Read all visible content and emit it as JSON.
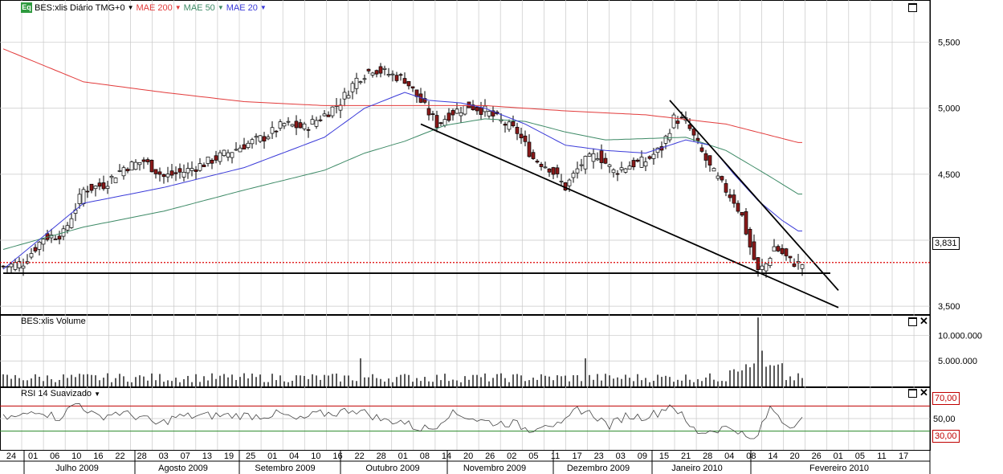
{
  "header": {
    "logo": "Eq",
    "symbol": "BES:xlis Diário TMG+0",
    "ma200": "MAE 200",
    "ma50": "MAE 50",
    "ma20": "MAE 20",
    "last_price": "3,831"
  },
  "volume_panel": {
    "title": "BES:xlis Volume",
    "ticks": [
      "10.000.000",
      "5.000.000"
    ]
  },
  "rsi_panel": {
    "title": "RSI 14 Suavizado",
    "upper": "70,00",
    "mid": "50,00",
    "lower": "30,00"
  },
  "colors": {
    "ma200": "#e23b3b",
    "ma50": "#3d8a66",
    "ma20": "#3b3bd9",
    "up": "#ffffff",
    "down": "#8b1a1a",
    "grid": "#c8c8c8"
  },
  "chart_data": {
    "type": "candlestick",
    "price_axis": {
      "ticks": [
        5.5,
        5.0,
        4.5,
        4.0,
        3.5
      ],
      "tick_labels": [
        "5,500",
        "5,000",
        "4,500",
        "4,000",
        "3,500"
      ],
      "ylim": [
        3.44,
        5.82
      ]
    },
    "x_day_labels": [
      "24",
      "01",
      "06",
      "10",
      "16",
      "22",
      "28",
      "03",
      "07",
      "13",
      "19",
      "25",
      "01",
      "04",
      "10",
      "16",
      "22",
      "28",
      "01",
      "08",
      "14",
      "20",
      "26",
      "02",
      "05",
      "11",
      "17",
      "23",
      "03",
      "09",
      "15",
      "21",
      "28",
      "04",
      "08",
      "14",
      "20",
      "26",
      "01",
      "05",
      "11",
      "17"
    ],
    "x_month_labels": [
      "Julho 2009",
      "Agosto 2009",
      "Setembro 2009",
      "Outubro 2009",
      "Novembro 2009",
      "Dezembro 2009",
      "Janeiro 2010",
      "Fevereiro 2010"
    ],
    "close_anchors": [
      [
        0,
        3.8
      ],
      [
        5,
        3.83
      ],
      [
        10,
        4.02
      ],
      [
        15,
        4.05
      ],
      [
        20,
        4.38
      ],
      [
        25,
        4.42
      ],
      [
        30,
        4.55
      ],
      [
        35,
        4.6
      ],
      [
        40,
        4.48
      ],
      [
        45,
        4.52
      ],
      [
        50,
        4.58
      ],
      [
        55,
        4.65
      ],
      [
        60,
        4.72
      ],
      [
        65,
        4.78
      ],
      [
        70,
        4.88
      ],
      [
        75,
        4.85
      ],
      [
        80,
        4.95
      ],
      [
        84,
        5.05
      ],
      [
        88,
        5.22
      ],
      [
        92,
        5.3
      ],
      [
        96,
        5.26
      ],
      [
        100,
        5.22
      ],
      [
        104,
        5.05
      ],
      [
        108,
        4.88
      ],
      [
        112,
        4.97
      ],
      [
        116,
        5.02
      ],
      [
        120,
        4.98
      ],
      [
        124,
        4.9
      ],
      [
        128,
        4.82
      ],
      [
        132,
        4.62
      ],
      [
        136,
        4.55
      ],
      [
        140,
        4.4
      ],
      [
        144,
        4.58
      ],
      [
        148,
        4.65
      ],
      [
        152,
        4.52
      ],
      [
        156,
        4.57
      ],
      [
        160,
        4.6
      ],
      [
        164,
        4.7
      ],
      [
        167,
        4.92
      ],
      [
        170,
        4.9
      ],
      [
        173,
        4.72
      ],
      [
        176,
        4.55
      ],
      [
        179,
        4.42
      ],
      [
        182,
        4.3
      ],
      [
        184,
        4.18
      ],
      [
        186,
        3.95
      ],
      [
        188,
        3.76
      ],
      [
        190,
        3.82
      ],
      [
        192,
        3.95
      ],
      [
        194,
        3.9
      ],
      [
        196,
        3.84
      ],
      [
        198,
        3.82
      ]
    ],
    "ma200_anchors": [
      [
        0,
        5.45
      ],
      [
        20,
        5.2
      ],
      [
        40,
        5.12
      ],
      [
        60,
        5.05
      ],
      [
        80,
        5.02
      ],
      [
        100,
        5.02
      ],
      [
        120,
        5.02
      ],
      [
        140,
        4.98
      ],
      [
        160,
        4.95
      ],
      [
        180,
        4.88
      ],
      [
        198,
        4.74
      ]
    ],
    "ma50_anchors": [
      [
        0,
        3.93
      ],
      [
        20,
        4.1
      ],
      [
        40,
        4.22
      ],
      [
        60,
        4.38
      ],
      [
        80,
        4.53
      ],
      [
        90,
        4.66
      ],
      [
        100,
        4.75
      ],
      [
        110,
        4.87
      ],
      [
        120,
        4.92
      ],
      [
        130,
        4.9
      ],
      [
        140,
        4.82
      ],
      [
        150,
        4.76
      ],
      [
        160,
        4.77
      ],
      [
        170,
        4.78
      ],
      [
        180,
        4.68
      ],
      [
        190,
        4.5
      ],
      [
        198,
        4.35
      ]
    ],
    "ma20_anchors": [
      [
        0,
        3.78
      ],
      [
        20,
        4.28
      ],
      [
        40,
        4.4
      ],
      [
        60,
        4.55
      ],
      [
        80,
        4.78
      ],
      [
        90,
        5.0
      ],
      [
        100,
        5.12
      ],
      [
        106,
        5.06
      ],
      [
        114,
        5.04
      ],
      [
        120,
        5.0
      ],
      [
        130,
        4.88
      ],
      [
        140,
        4.72
      ],
      [
        150,
        4.68
      ],
      [
        160,
        4.66
      ],
      [
        170,
        4.76
      ],
      [
        176,
        4.72
      ],
      [
        182,
        4.5
      ],
      [
        188,
        4.3
      ],
      [
        194,
        4.15
      ],
      [
        198,
        4.07
      ]
    ],
    "volume_range": [
      0,
      14000000
    ],
    "rsi_range": [
      0,
      100
    ],
    "rsi_levels": [
      70,
      30
    ],
    "trendlines": [
      {
        "from": [
          104,
          4.88
        ],
        "to": [
          208,
          3.49
        ]
      },
      {
        "from": [
          166,
          5.06
        ],
        "to": [
          208,
          3.62
        ]
      },
      {
        "from": [
          0,
          3.75
        ],
        "to": [
          206,
          3.75
        ]
      }
    ]
  }
}
